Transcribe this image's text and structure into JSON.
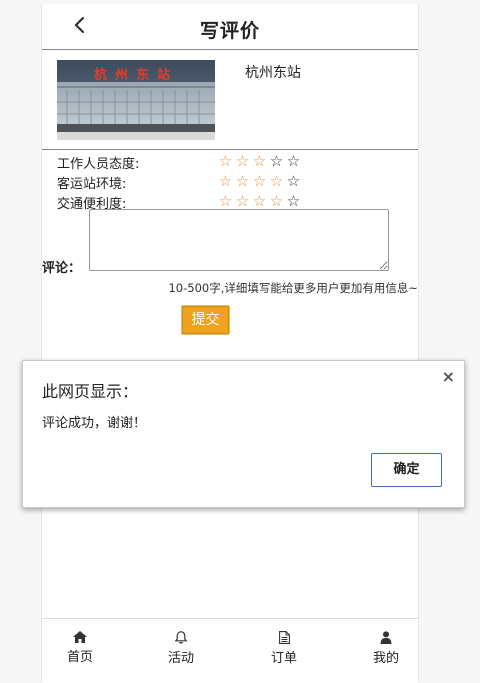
{
  "header": {
    "title": "写评价",
    "back_icon": "chevron-left-icon"
  },
  "station": {
    "name": "杭州东站",
    "photo_sign_text": "杭州东站"
  },
  "ratings": [
    {
      "label": "工作人员态度:",
      "score": 3,
      "max": 5
    },
    {
      "label": "客运站环境:",
      "score": 4,
      "max": 5
    },
    {
      "label": "交通便利度:",
      "score": 4,
      "max": 5
    }
  ],
  "star_colors": {
    "filled": "#ea9149",
    "empty": "#333333"
  },
  "comment": {
    "label": "评论：",
    "value": "",
    "hint": "10-500字,详细填写能给更多用户更加有用信息~"
  },
  "submit_label": "提交",
  "dialog": {
    "title": "此网页显示：",
    "message": "评论成功，谢谢！",
    "ok_label": "确定",
    "close_glyph": "×"
  },
  "tabbar": [
    {
      "label": "首页",
      "icon": "home-icon"
    },
    {
      "label": "活动",
      "icon": "bell-icon"
    },
    {
      "label": "订单",
      "icon": "document-icon"
    },
    {
      "label": "我的",
      "icon": "user-icon"
    }
  ],
  "colors": {
    "submit_button": "#f0a21f",
    "dialog_ok_border": "#3f6dbd"
  }
}
